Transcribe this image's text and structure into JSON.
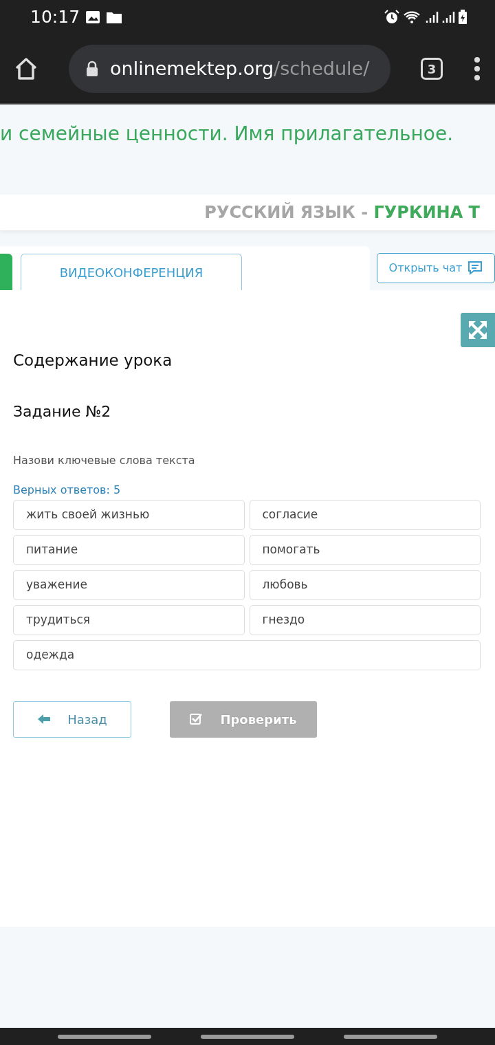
{
  "status_bar": {
    "time": "10:17"
  },
  "browser": {
    "url_host": "onlinemektep.org",
    "url_path": "/schedule/",
    "tab_count": "3"
  },
  "lesson_title": "и семейные ценности. Имя прилагательное.",
  "header": {
    "subject": "РУССКИЙ ЯЗЫК -",
    "teacher": "ГУРКИНА Т"
  },
  "tabs": [
    {
      "kind": "partial",
      "selected": true
    },
    {
      "kind": "full",
      "label": "ВИДЕОКОНФЕРЕНЦИЯ",
      "selected": false
    }
  ],
  "chat_button": "Открыть чат",
  "content": {
    "heading": "Содержание урока",
    "task_title": "Задание №2",
    "question": "Назови ключевые слова текста",
    "correct_count": "Верных ответов: 5",
    "answers": [
      {
        "text": "жить своей жизнью"
      },
      {
        "text": "согласие"
      },
      {
        "text": "питание"
      },
      {
        "text": "помогать"
      },
      {
        "text": "уважение"
      },
      {
        "text": "любовь"
      },
      {
        "text": "трудиться"
      },
      {
        "text": "гнездо"
      },
      {
        "text": "одежда"
      }
    ],
    "buttons": [
      {
        "kind": "back",
        "label": "Назад",
        "disabled": false
      },
      {
        "kind": "check",
        "label": "Проверить",
        "disabled": true
      }
    ]
  }
}
